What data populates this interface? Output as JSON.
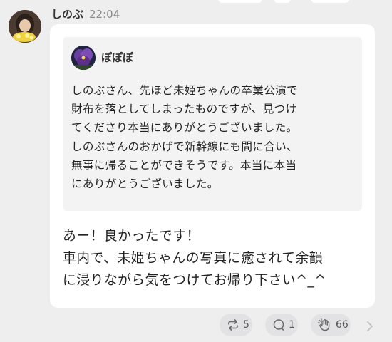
{
  "post": {
    "author": "しのぶ",
    "time": "22:04"
  },
  "quote": {
    "author": "ぽぽぽ",
    "lines": [
      "しのぶさん、先ほど未姫ちゃんの卒業公演で",
      "財布を落としてしまったものですが、見つけ",
      "てくださり本当にありがとうございました。",
      "しのぶさんのおかげで新幹線にも間に合い、",
      "無事に帰ることができそうです。本当に本当",
      "にありがとうございました。"
    ]
  },
  "reply": {
    "lines": [
      "あー！良かったです！",
      "車内で、未姫ちゃんの写真に癒されて余韻",
      "に浸りながら気をつけてお帰り下さい^_^"
    ]
  },
  "actions": {
    "repost_count": "5",
    "comment_count": "1",
    "like_count": "66"
  },
  "icons": [
    "repost-icon",
    "comment-icon",
    "clap-icon",
    "chevron-right-icon"
  ]
}
